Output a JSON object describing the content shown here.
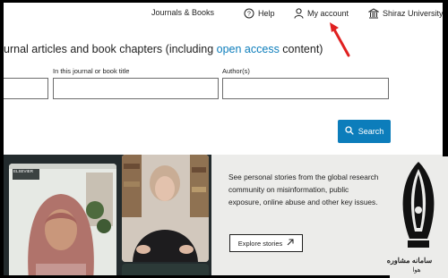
{
  "nav": {
    "journals_books": "Journals & Books",
    "help": "Help",
    "my_account": "My account",
    "institution": "Shiraz University"
  },
  "search": {
    "headline_prefix": "urnal articles and book chapters (including ",
    "headline_link": "open access",
    "headline_suffix": " content)",
    "journal_label": "In this journal or book title",
    "author_label": "Author(s)",
    "button_label": "Search"
  },
  "stories": {
    "logo_label": "ELSEVIER",
    "description": "See personal stories from the global research community on misinformation, public exposure, online abuse and other key issues.",
    "button_label": "Explore stories"
  },
  "watermark": {
    "line1": "سامانه مشاوره",
    "line2": "هوا"
  },
  "colors": {
    "accent": "#0c7dbb",
    "annotation_arrow": "#e02020"
  }
}
